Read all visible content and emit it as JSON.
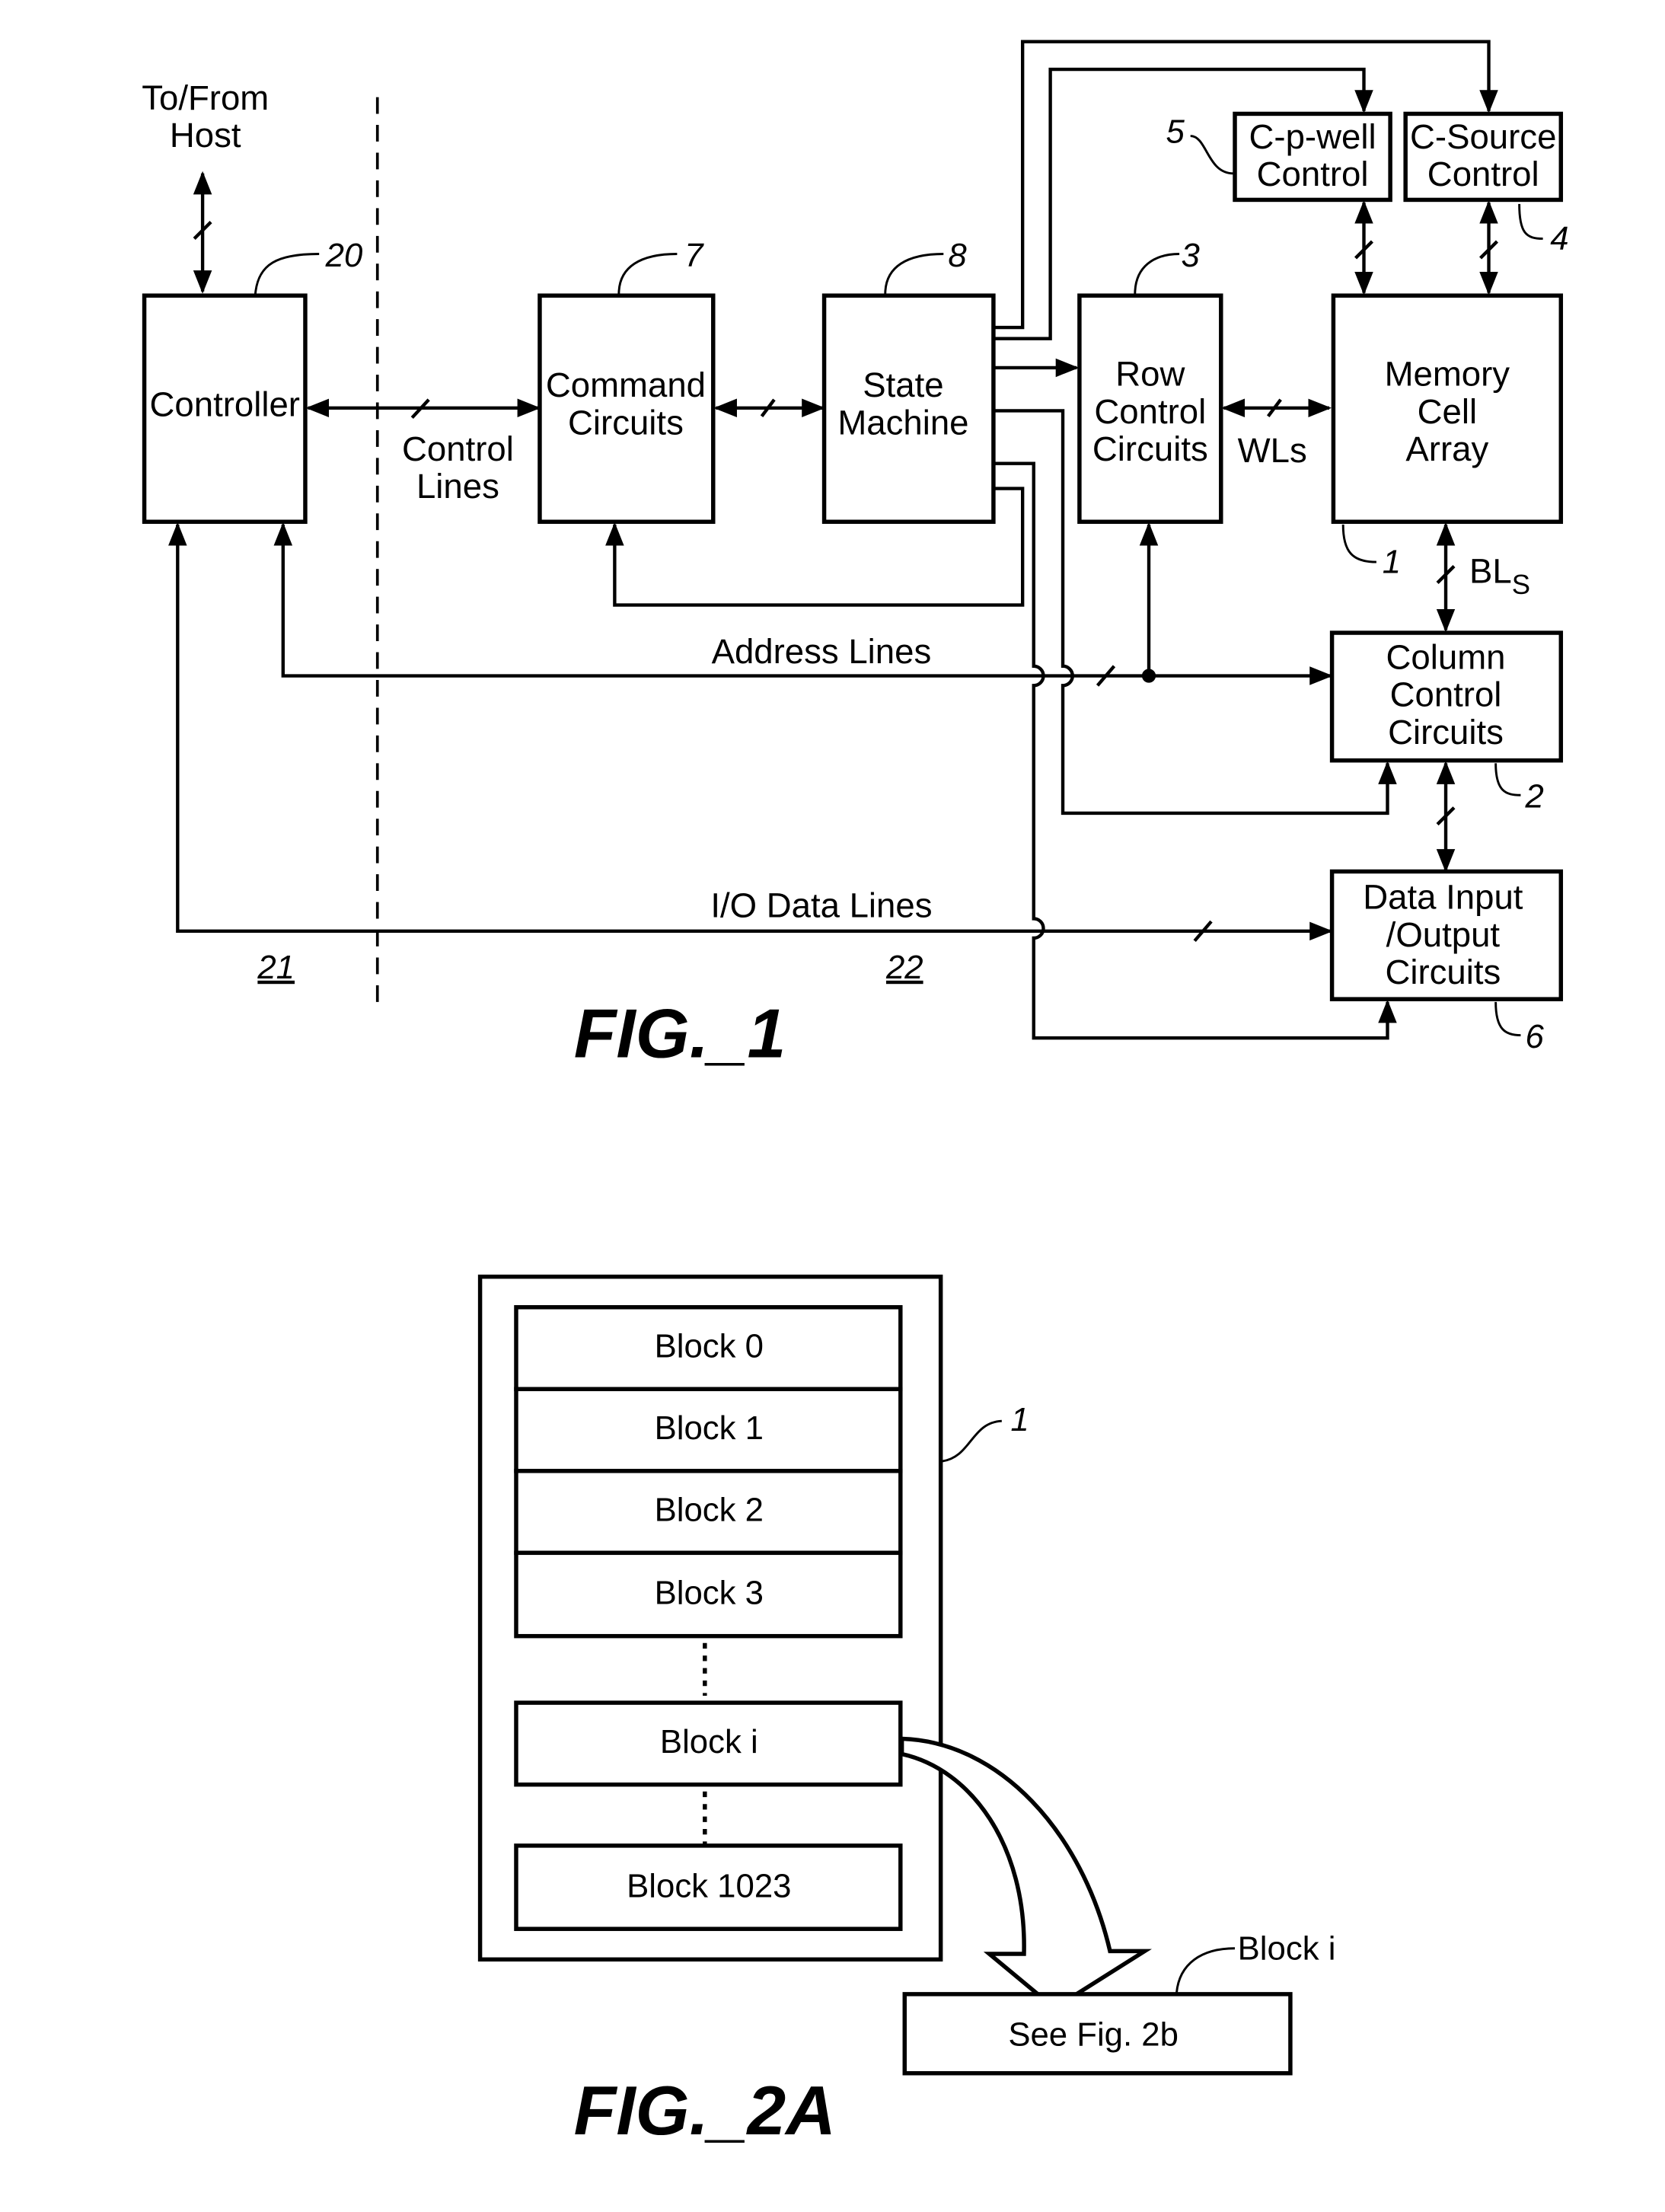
{
  "fig1": {
    "caption": "FIG._1",
    "host_label_line1": "To/From",
    "host_label_line2": "Host",
    "blocks": {
      "controller": {
        "label": "Controller",
        "ref": "20"
      },
      "command": {
        "line1": "Command",
        "line2": "Circuits",
        "ref": "7"
      },
      "state": {
        "line1": "State",
        "line2": "Machine",
        "ref": "8"
      },
      "row": {
        "line1": "Row",
        "line2": "Control",
        "line3": "Circuits",
        "ref": "3"
      },
      "memory": {
        "line1": "Memory",
        "line2": "Cell",
        "line3": "Array",
        "ref": "1"
      },
      "cpwell": {
        "line1": "C-p-well",
        "line2": "Control",
        "ref": "5"
      },
      "csource": {
        "line1": "C-Source",
        "line2": "Control",
        "ref": "4"
      },
      "column": {
        "line1": "Column",
        "line2": "Control",
        "line3": "Circuits",
        "ref": "2"
      },
      "dataio": {
        "line1": "Data Input",
        "line2": "/Output",
        "line3": "Circuits",
        "ref": "6"
      }
    },
    "signals": {
      "control_lines_1": "Control",
      "control_lines_2": "Lines",
      "wls": "WLs",
      "bls_main": "BL",
      "bls_sub": "S",
      "address_lines": "Address Lines",
      "io_data_lines": "I/O Data Lines"
    },
    "regions": {
      "left": "21",
      "right": "22"
    }
  },
  "fig2a": {
    "caption": "FIG._2A",
    "array_ref": "1",
    "blocks": [
      "Block 0",
      "Block 1",
      "Block 2",
      "Block 3",
      "Block i",
      "Block 1023"
    ],
    "detail_label": "Block i",
    "detail_box": "See Fig. 2b"
  }
}
